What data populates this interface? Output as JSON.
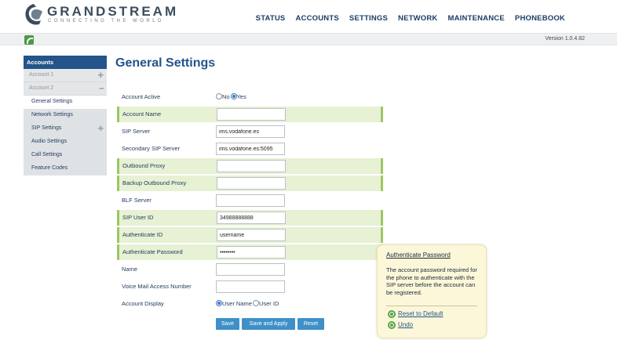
{
  "header": {
    "brand": "GRANDSTREAM",
    "tagline": "CONNECTING THE WORLD",
    "nav": [
      "STATUS",
      "ACCOUNTS",
      "SETTINGS",
      "NETWORK",
      "MAINTENANCE",
      "PHONEBOOK"
    ]
  },
  "version": "Version 1.0.4.82",
  "sidebar": {
    "heading": "Accounts",
    "account1": "Account 1",
    "account2": "Account 2",
    "items": [
      "General Settings",
      "Network Settings",
      "SIP Settings",
      "Audio Settings",
      "Call Settings",
      "Feature Codes"
    ]
  },
  "page_title": "General Settings",
  "form": {
    "account_active": {
      "label": "Account Active",
      "opt_no": "No",
      "opt_yes": "Yes"
    },
    "account_name": {
      "label": "Account Name",
      "value": ""
    },
    "sip_server": {
      "label": "SIP Server",
      "value": "ims.vodafone.es"
    },
    "secondary_sip_server": {
      "label": "Secondary SIP Server",
      "value": "ims.vodafone.es:5095"
    },
    "outbound_proxy": {
      "label": "Outbound Proxy",
      "value": ""
    },
    "backup_outbound_proxy": {
      "label": "Backup Outbound Proxy",
      "value": ""
    },
    "blf_server": {
      "label": "BLF Server",
      "value": ""
    },
    "sip_user_id": {
      "label": "SIP User ID",
      "value": "34988888888"
    },
    "authenticate_id": {
      "label": "Authenticate ID",
      "value": "username"
    },
    "authenticate_password": {
      "label": "Authenticate Password",
      "value": "password"
    },
    "name": {
      "label": "Name",
      "value": ""
    },
    "voice_mail": {
      "label": "Voice Mail Access Number",
      "value": ""
    },
    "account_display": {
      "label": "Account Display",
      "opt_user_name": "User Name",
      "opt_user_id": "User ID"
    }
  },
  "buttons": {
    "save": "Save",
    "save_apply": "Save and Apply",
    "reset": "Reset"
  },
  "tooltip": {
    "title": "Authenticate Password",
    "body": "The account password required for the phone to authenticate with the SIP server before the account can be registered.",
    "reset_default": "Reset to Default",
    "undo": "Undo"
  },
  "colors": {
    "nav_blue": "#23548a",
    "highlight_green": "#e7f1d4",
    "button_blue": "#3f90c9",
    "tooltip_bg": "#fdf7d9"
  }
}
